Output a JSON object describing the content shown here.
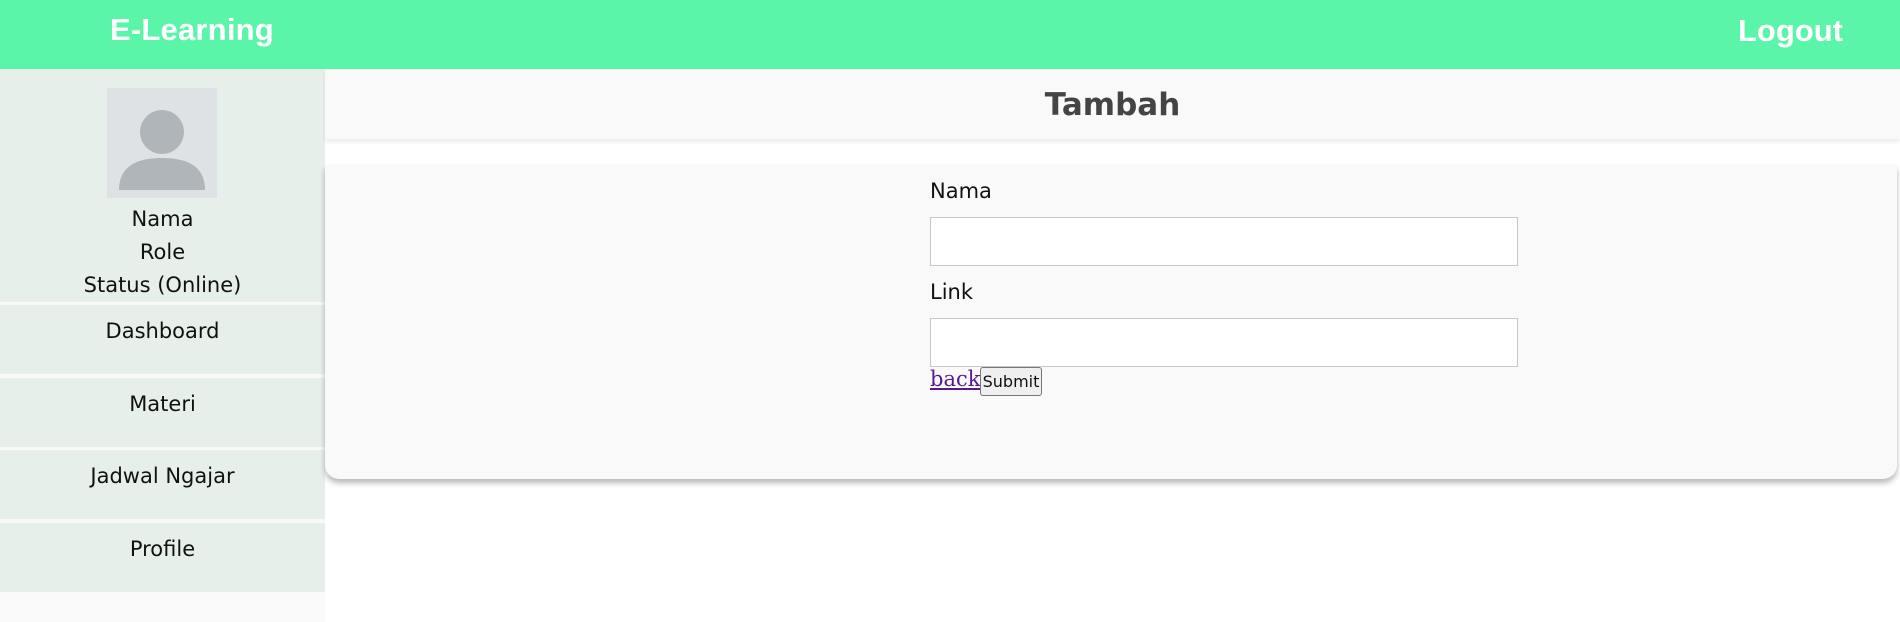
{
  "header": {
    "brand": "E-Learning",
    "logout_label": "Logout",
    "background_color": "#5bf5a9"
  },
  "sidebar": {
    "profile": {
      "name": "Nama",
      "role": "Role",
      "status": "Status (Online)",
      "avatar_icon": "user-silhouette-icon"
    },
    "items": [
      {
        "label": "Dashboard"
      },
      {
        "label": "Materi"
      },
      {
        "label": "Jadwal Ngajar"
      },
      {
        "label": "Profile"
      }
    ]
  },
  "main": {
    "title": "Tambah",
    "form": {
      "fields": [
        {
          "label": "Nama",
          "value": "",
          "placeholder": ""
        },
        {
          "label": "Link",
          "value": "",
          "placeholder": ""
        }
      ],
      "back_label": "back",
      "submit_label": "Submit"
    }
  }
}
